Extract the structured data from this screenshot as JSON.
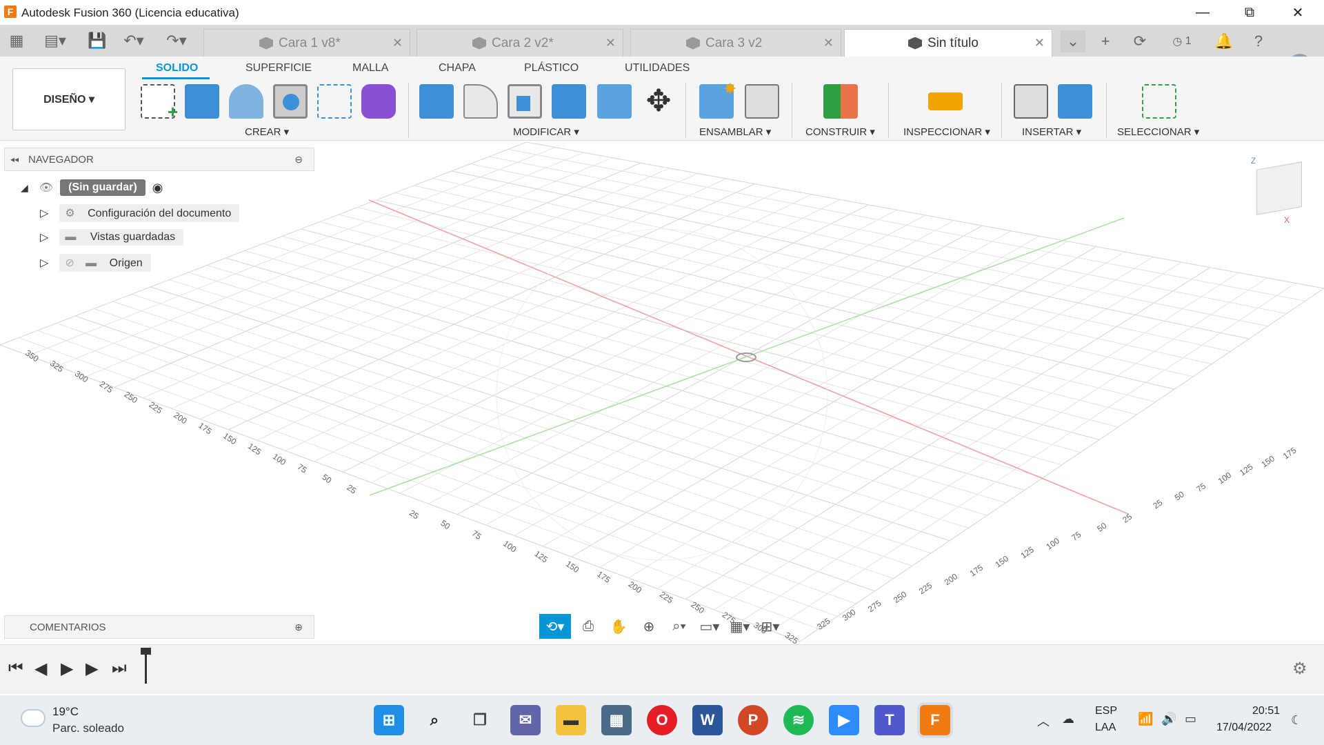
{
  "window": {
    "title": "Autodesk Fusion 360 (Licencia educativa)",
    "logo": "F",
    "min": "—",
    "max": "⧉",
    "close": "✕"
  },
  "tabs": [
    {
      "label": "Cara 1 v8*",
      "active": false
    },
    {
      "label": "Cara 2 v2*",
      "active": false
    },
    {
      "label": "Cara 3 v2",
      "active": false
    },
    {
      "label": "Sin título",
      "active": true
    }
  ],
  "tabbar": {
    "job_count": "1"
  },
  "ribbon": {
    "workspace": "DISEÑO ▾",
    "tabs": [
      "SOLIDO",
      "SUPERFICIE",
      "MALLA",
      "CHAPA",
      "PLÁSTICO",
      "UTILIDADES"
    ],
    "groups": [
      "CREAR ▾",
      "MODIFICAR ▾",
      "ENSAMBLAR ▾",
      "CONSTRUIR ▾",
      "INSPECCIONAR ▾",
      "INSERTAR ▾",
      "SELECCIONAR ▾"
    ]
  },
  "navigator": {
    "title": "NAVEGADOR",
    "root": "(Sin guardar)",
    "items": [
      "Configuración del documento",
      "Vistas guardadas",
      "Origen"
    ]
  },
  "comments": {
    "title": "COMENTARIOS"
  },
  "grid_labels": {
    "left_axis": [
      "350",
      "325",
      "300",
      "275",
      "250",
      "225",
      "200",
      "175",
      "150",
      "125",
      "100",
      "75",
      "50",
      "25"
    ],
    "front_axis": [
      "25",
      "50",
      "75",
      "100",
      "125",
      "150",
      "175",
      "200",
      "225",
      "250",
      "275",
      "300",
      "325"
    ],
    "right_axis": [
      "25",
      "50",
      "75",
      "100",
      "125",
      "150",
      "175",
      "200",
      "225",
      "250",
      "275",
      "300",
      "325"
    ],
    "right_edge": [
      "175",
      "150",
      "125",
      "100",
      "75",
      "50",
      "25"
    ]
  },
  "viewcube": {
    "z_label": "Z",
    "x_label": "X"
  },
  "taskbar": {
    "weather_temp": "19°C",
    "weather_desc": "Parc. soleado",
    "lang1": "ESP",
    "lang2": "LAA",
    "time": "20:51",
    "date": "17/04/2022"
  }
}
